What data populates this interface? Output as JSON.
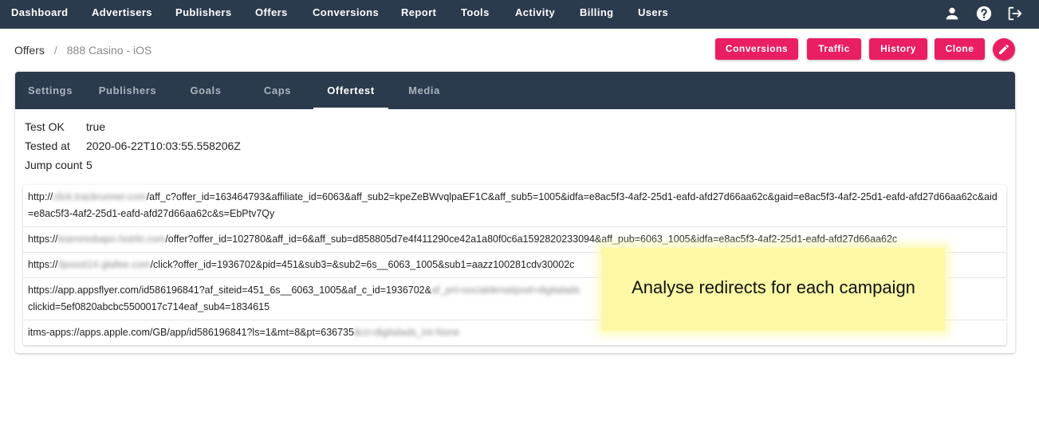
{
  "nav": {
    "items": [
      "Dashboard",
      "Advertisers",
      "Publishers",
      "Offers",
      "Conversions",
      "Report",
      "Tools",
      "Activity",
      "Billing",
      "Users"
    ],
    "icons": [
      "account-icon",
      "help-icon",
      "logout-icon"
    ]
  },
  "breadcrumb": {
    "parent": "Offers",
    "separator": "/",
    "current": "888 Casino - iOS"
  },
  "actions": {
    "conversions": "Conversions",
    "traffic": "Traffic",
    "history": "History",
    "clone": "Clone",
    "edit_icon": "pencil-icon"
  },
  "tabs": [
    "Settings",
    "Publishers",
    "Goals",
    "Caps",
    "Offertest",
    "Media"
  ],
  "active_tab": "Offertest",
  "test": {
    "ok_label": "Test OK",
    "ok_value": "true",
    "tested_label": "Tested at",
    "tested_value": "2020-06-22T10:03:55.558206Z",
    "jump_label": "Jump count",
    "jump_value": "5"
  },
  "redirects": [
    {
      "pre": "http://",
      "blur": "click.trackrunner.com",
      "post": "/aff_c?offer_id=163464793&affiliate_id=6063&aff_sub2=kpeZeBWvqlpaEF1C&aff_sub5=1005&idfa=e8ac5f3-4af2-25d1-eafd-afd27d66aa62c&gaid=e8ac5f3-4af2-25d1-eafd-afd27d66aa62c&aid=e8ac5f3-4af2-25d1-eafd-afd27d66aa62c&s=EbPtv7Qy"
    },
    {
      "pre": "https://",
      "blur": "learnmobapo.hotrkt.com",
      "post": "/offer?offer_id=102780&aff_id=6&aff_sub=d858805d7e4f411290ce42a1a80f0c6a1592820233094&aff_pub=6063_1005&idfa=e8ac5f3-4af2-25d1-eafd-afd27d66aa62c"
    },
    {
      "pre": "https://",
      "blur": "3posst14.gtafee.com",
      "post": "/click?offer_id=1936702&pid=451&sub3=&sub2=6s__6063_1005&sub1=aazz100281cdv30002c"
    },
    {
      "pre": "https://app.appsflyer.com/id586196841?af_siteid=451_6s__6063_1005&af_c_id=1936702&",
      "blur": "af_prt=socialdenatipod=digitalads",
      "post": "clickid=5ef0820abcbc5500017c714eaf_sub4=1834615"
    },
    {
      "pre": "itms-apps://apps.apple.com/GB/app/id586196841?ls=1&mt=8&pt=636735",
      "blur": "&ct=digitalads_int-None",
      "post": ""
    }
  ],
  "callout": "Analyse redirects for each campaign",
  "colors": {
    "nav_bg": "#2b3a4c",
    "accent": "#e91e63",
    "callout_bg": "#fdf8a5"
  }
}
